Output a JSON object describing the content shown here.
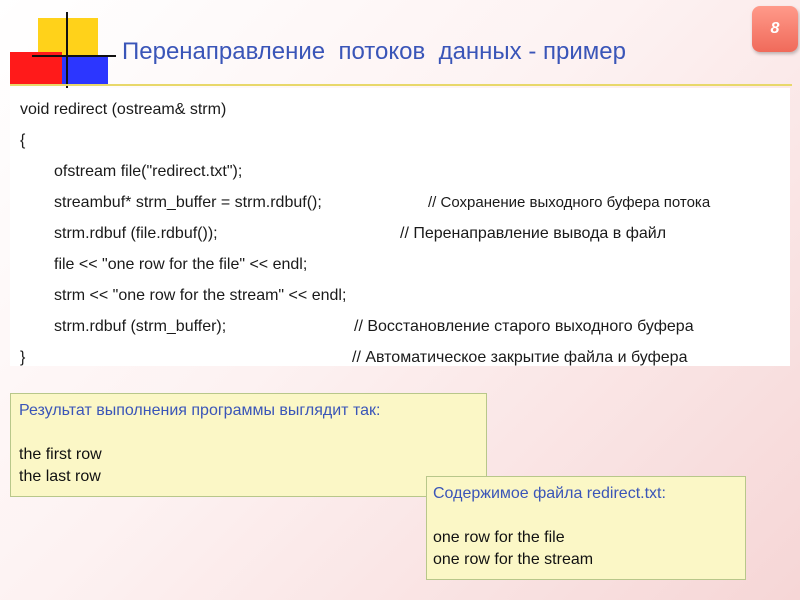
{
  "slide": {
    "title": "Перенаправление  потоков  данных - пример",
    "page_number": "8"
  },
  "code": {
    "lines": [
      {
        "stmt": "void redirect (ostream& strm)",
        "comment": ""
      },
      {
        "stmt": "{",
        "comment": ""
      },
      {
        "stmt": "ofstream file(\"redirect.txt\");",
        "comment": ""
      },
      {
        "stmt": "streambuf* strm_buffer = strm.rdbuf();",
        "comment": "// Сохранение выходного буфера потока"
      },
      {
        "stmt": "strm.rdbuf (file.rdbuf());",
        "comment": "// Перенаправление вывода в файл"
      },
      {
        "stmt": "file << \"one row for the file\" << endl;",
        "comment": ""
      },
      {
        "stmt": "strm << \"one row for the stream\" << endl;",
        "comment": ""
      },
      {
        "stmt": "strm.rdbuf (strm_buffer);",
        "comment": "// Восстановление старого выходного буфера"
      },
      {
        "stmt": "}",
        "comment": "// Автоматическое закрытие файла и буфера"
      }
    ]
  },
  "result_box": {
    "heading": "Результат выполнения программы выглядит так:",
    "lines": [
      "the first row",
      "the last row"
    ]
  },
  "file_box": {
    "heading": "Содержимое файла redirect.txt:",
    "lines": [
      "one row for the file",
      "one row for the stream"
    ]
  },
  "colors": {
    "title": "#3a55b8",
    "badge": "#f06a5a",
    "note_background": "#fbf7c6"
  }
}
